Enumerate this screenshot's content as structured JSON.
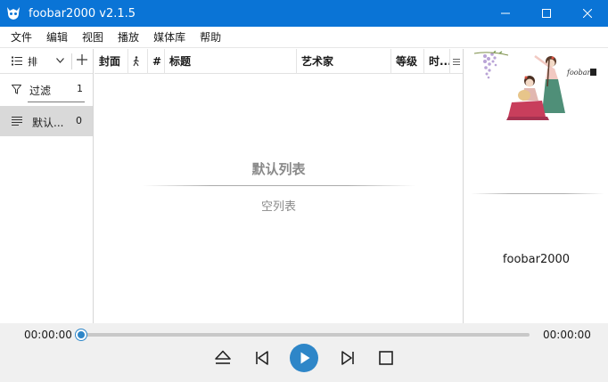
{
  "window": {
    "title": "foobar2000 v2.1.5",
    "accent_color": "#0a74d6",
    "buttons": [
      "minimize-icon",
      "maximize-icon",
      "close-icon"
    ]
  },
  "menu": {
    "items": [
      "文件",
      "编辑",
      "视图",
      "播放",
      "媒体库",
      "帮助"
    ]
  },
  "left_panel": {
    "sort_label": "排",
    "filter_label": "过滤",
    "filter_count": "1",
    "playlist_name": "默认...",
    "playlist_count": "0"
  },
  "columns": [
    "封面",
    "",
    "#",
    "标题",
    "艺术家",
    "等级",
    "时..."
  ],
  "playlist_view": {
    "empty_title": "默认列表",
    "empty_subtitle": "空列表"
  },
  "right_panel": {
    "art_logo_text": "foobar",
    "app_name": "foobar2000"
  },
  "playback": {
    "time_elapsed": "00:00:00",
    "time_total": "00:00:00",
    "progress": 0,
    "seek_color": "#2e86c8",
    "controls": [
      "eject-icon",
      "previous-icon",
      "play-icon",
      "next-icon",
      "stop-icon"
    ]
  }
}
